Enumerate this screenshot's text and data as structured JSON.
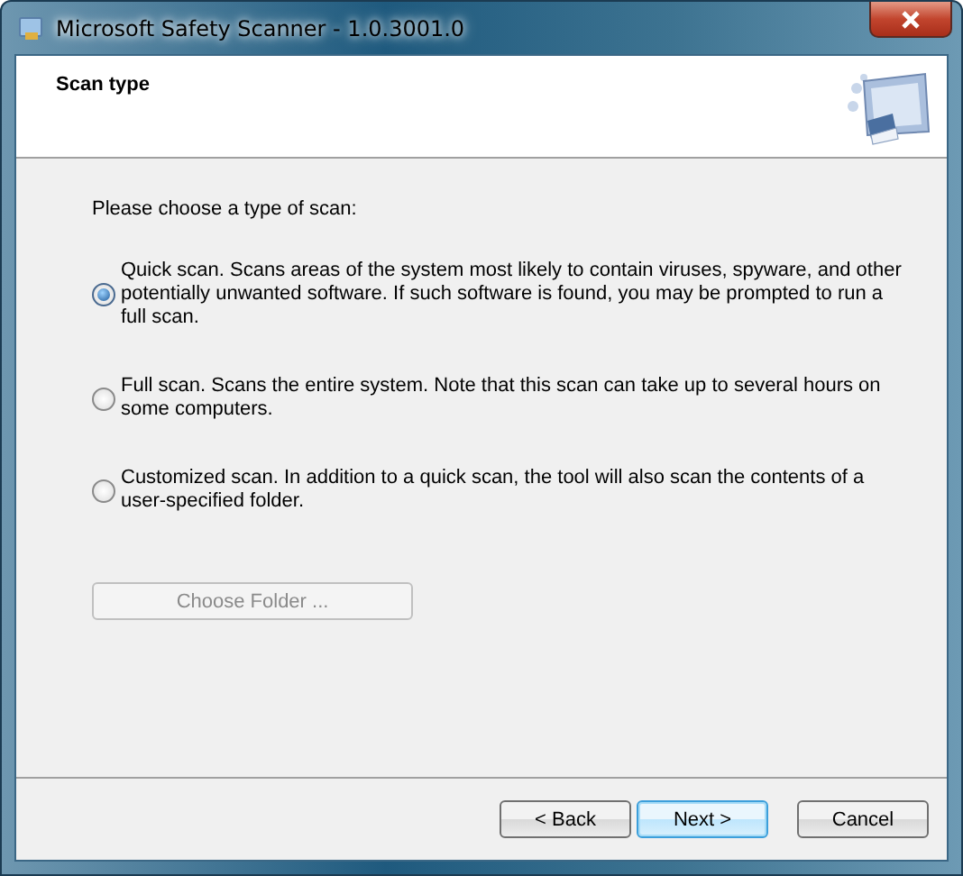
{
  "window": {
    "title": "Microsoft Safety Scanner - 1.0.3001.0"
  },
  "header": {
    "title": "Scan type"
  },
  "prompt": "Please choose a type of scan:",
  "options": [
    {
      "label": "Quick scan. Scans areas of the system most likely to contain viruses, spyware, and other potentially unwanted software. If such software is found, you may be prompted to run a full scan.",
      "selected": true
    },
    {
      "label": "Full scan. Scans the entire system. Note that this scan can take up to several hours on some computers.",
      "selected": false
    },
    {
      "label": "Customized scan. In addition to a quick scan, the tool will also scan the contents of a user-specified folder.",
      "selected": false
    }
  ],
  "folder_button": {
    "label": "Choose Folder ...",
    "disabled": true
  },
  "buttons": [
    {
      "label": "< Back",
      "default": false
    },
    {
      "label": "Next >",
      "default": true
    },
    {
      "label": "Cancel",
      "default": false
    }
  ]
}
